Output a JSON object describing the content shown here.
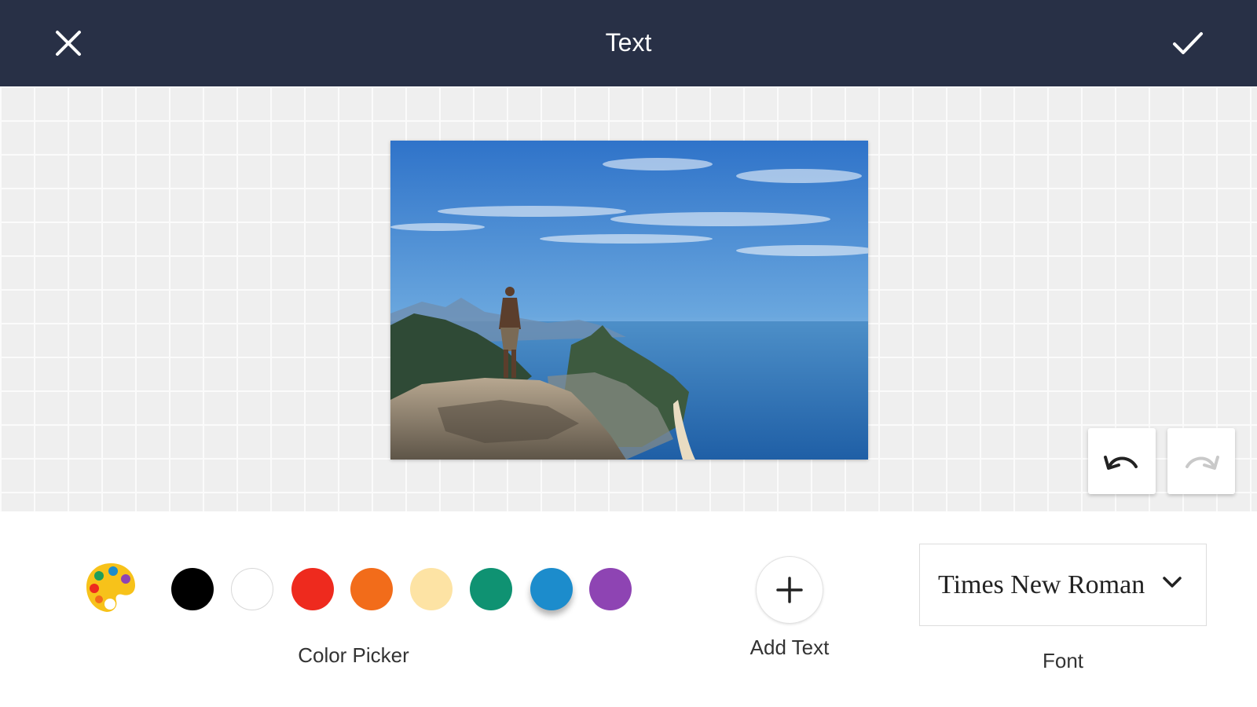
{
  "header": {
    "title": "Text",
    "close_icon": "close-icon",
    "confirm_icon": "checkmark-icon",
    "background": "#283046"
  },
  "canvas": {
    "image": "photo of a man standing on a rocky cliff overlooking a coastal city and ocean",
    "undo_icon": "undo-icon",
    "redo_icon": "redo-icon",
    "redo_enabled": false
  },
  "tools": {
    "color_picker": {
      "label": "Color Picker",
      "palette_icon": "palette-icon",
      "swatches": [
        {
          "name": "black",
          "color": "#000000",
          "selected": false
        },
        {
          "name": "white",
          "color": "#ffffff",
          "selected": false
        },
        {
          "name": "red",
          "color": "#ee2a1e",
          "selected": false
        },
        {
          "name": "orange",
          "color": "#f26c1a",
          "selected": false
        },
        {
          "name": "cream",
          "color": "#fde3a4",
          "selected": false
        },
        {
          "name": "green",
          "color": "#0f9272",
          "selected": false
        },
        {
          "name": "blue",
          "color": "#1c8ccc",
          "selected": true
        },
        {
          "name": "purple",
          "color": "#8e44b3",
          "selected": false
        }
      ]
    },
    "add_text": {
      "label": "Add Text",
      "icon": "plus-icon"
    },
    "font": {
      "label": "Font",
      "value": "Times New Roman",
      "icon": "chevron-down-icon"
    }
  }
}
